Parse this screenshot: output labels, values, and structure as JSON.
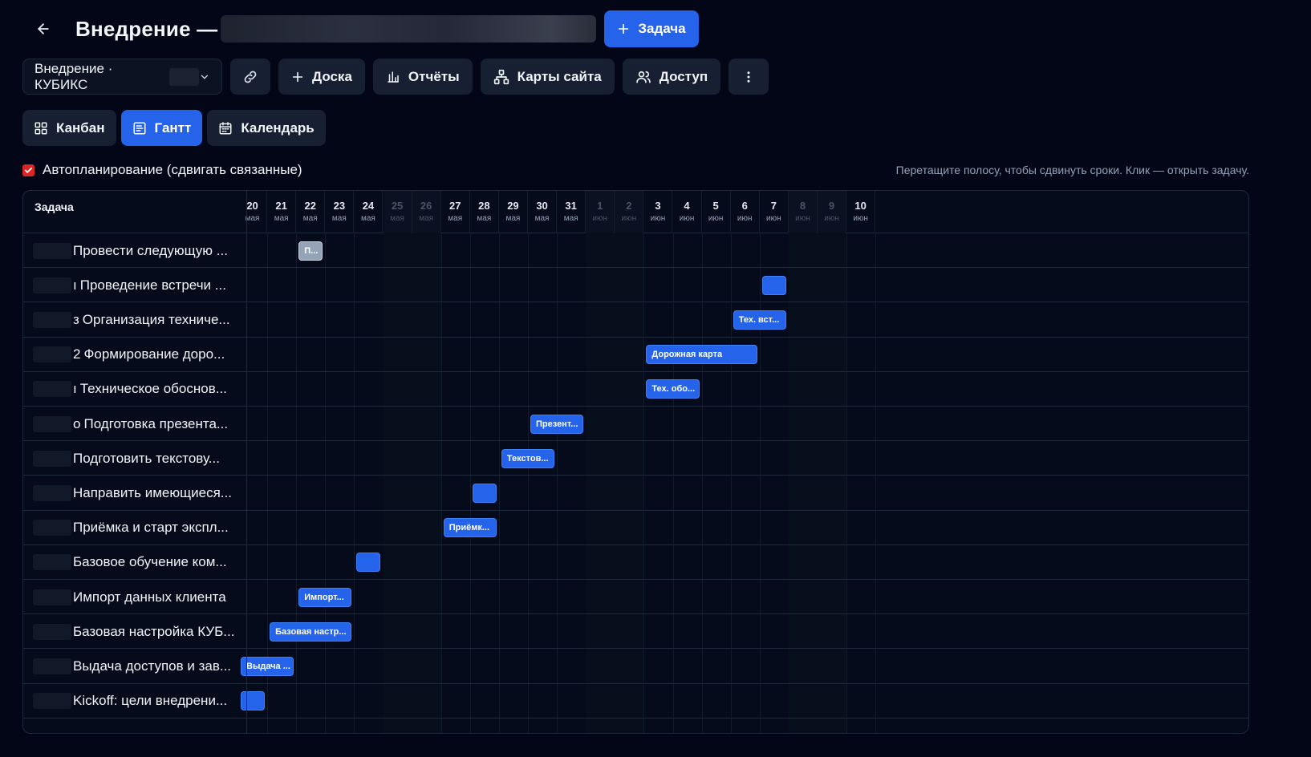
{
  "header": {
    "title": "Внедрение —",
    "add_task_label": "Задача"
  },
  "toolbar": {
    "project_select": "Внедрение · КУБИКС",
    "board_label": "Доска",
    "reports_label": "Отчёты",
    "sitemaps_label": "Карты сайта",
    "access_label": "Доступ"
  },
  "views": {
    "kanban": "Канбан",
    "gantt": "Гантт",
    "calendar": "Календарь"
  },
  "options": {
    "autoplan_label": "Автопланирование (сдвигать связанные)",
    "autoplan_checked": true,
    "hint": "Перетащите полосу, чтобы сдвинуть сроки. Клик — открыть задачу."
  },
  "gantt": {
    "task_col_title": "Задача",
    "days": [
      {
        "d": "20",
        "m": "мая",
        "weekend": false
      },
      {
        "d": "21",
        "m": "мая",
        "weekend": false
      },
      {
        "d": "22",
        "m": "мая",
        "weekend": false
      },
      {
        "d": "23",
        "m": "мая",
        "weekend": false
      },
      {
        "d": "24",
        "m": "мая",
        "weekend": false
      },
      {
        "d": "25",
        "m": "мая",
        "weekend": true
      },
      {
        "d": "26",
        "m": "мая",
        "weekend": true
      },
      {
        "d": "27",
        "m": "мая",
        "weekend": false
      },
      {
        "d": "28",
        "m": "мая",
        "weekend": false
      },
      {
        "d": "29",
        "m": "мая",
        "weekend": false
      },
      {
        "d": "30",
        "m": "мая",
        "weekend": false
      },
      {
        "d": "31",
        "m": "мая",
        "weekend": false
      },
      {
        "d": "1",
        "m": "июн",
        "weekend": true
      },
      {
        "d": "2",
        "m": "июн",
        "weekend": true
      },
      {
        "d": "3",
        "m": "июн",
        "weekend": false
      },
      {
        "d": "4",
        "m": "июн",
        "weekend": false
      },
      {
        "d": "5",
        "m": "июн",
        "weekend": false
      },
      {
        "d": "6",
        "m": "июн",
        "weekend": false
      },
      {
        "d": "7",
        "m": "июн",
        "weekend": false
      },
      {
        "d": "8",
        "m": "июн",
        "weekend": true
      },
      {
        "d": "9",
        "m": "июн",
        "weekend": true
      },
      {
        "d": "10",
        "m": "июн",
        "weekend": false
      }
    ],
    "tasks": [
      {
        "name": "Провести следующую ...",
        "prefix": "",
        "bar_label": "П...",
        "start": 2,
        "days": 1,
        "color": "gray"
      },
      {
        "name": "Проведение встречи ...",
        "prefix": "ı",
        "bar_label": "",
        "start": 18,
        "days": 1,
        "color": "blue"
      },
      {
        "name": "Организация техниче...",
        "prefix": "з",
        "bar_label": "Тех. вст...",
        "start": 17,
        "days": 2,
        "color": "blue"
      },
      {
        "name": "Формирование доро...",
        "prefix": "2",
        "bar_label": "Дорожная карта",
        "start": 14,
        "days": 4,
        "color": "blue"
      },
      {
        "name": "Техническое обоснов...",
        "prefix": "ı",
        "bar_label": "Тех. обо...",
        "start": 14,
        "days": 2,
        "color": "blue"
      },
      {
        "name": "Подготовка презента...",
        "prefix": "о",
        "bar_label": "Презент...",
        "start": 10,
        "days": 2,
        "color": "blue"
      },
      {
        "name": "Подготовить текстову...",
        "prefix": "",
        "bar_label": "Текстов...",
        "start": 9,
        "days": 2,
        "color": "blue"
      },
      {
        "name": "Направить имеющиеся...",
        "prefix": "",
        "bar_label": "",
        "start": 8,
        "days": 1,
        "color": "blue"
      },
      {
        "name": "Приёмка и старт экспл...",
        "prefix": "",
        "bar_label": "Приёмк...",
        "start": 7,
        "days": 2,
        "color": "blue"
      },
      {
        "name": "Базовое обучение ком...",
        "prefix": "",
        "bar_label": "",
        "start": 4,
        "days": 1,
        "color": "blue"
      },
      {
        "name": "Импорт данных клиента",
        "prefix": "",
        "bar_label": "Импорт...",
        "start": 2,
        "days": 2,
        "color": "blue"
      },
      {
        "name": "Базовая настройка КУБ...",
        "prefix": "",
        "bar_label": "Базовая настр...",
        "start": 1,
        "days": 3,
        "color": "blue"
      },
      {
        "name": "Выдача доступов и зав...",
        "prefix": "",
        "bar_label": "Выдача ...",
        "start": 0,
        "days": 2,
        "color": "blue"
      },
      {
        "name": "Kickoff: цели внедрени...",
        "prefix": "",
        "bar_label": "",
        "start": 0,
        "days": 1,
        "color": "blue"
      }
    ]
  }
}
